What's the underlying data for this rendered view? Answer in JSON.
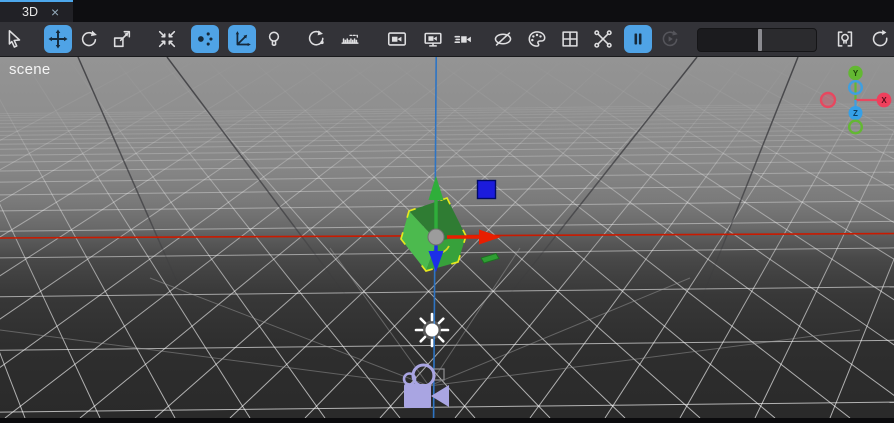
{
  "window": {
    "tab_label": "3D",
    "close_glyph": "×",
    "scene_label": "scene"
  },
  "toolbar": {
    "active_color": "#4fa3e6",
    "background": "#333338",
    "buttons": [
      {
        "name": "select-tool",
        "state": "normal"
      },
      {
        "name": "move-tool",
        "state": "active"
      },
      {
        "name": "rotate-tool",
        "state": "normal"
      },
      {
        "name": "scale-tool",
        "state": "normal"
      },
      {
        "name": "focus-selection",
        "state": "normal"
      },
      {
        "name": "snap-vertex",
        "state": "active"
      },
      {
        "name": "transform-space",
        "state": "active"
      },
      {
        "name": "lighting-toggle",
        "state": "normal"
      },
      {
        "name": "orbit-mode",
        "state": "normal"
      },
      {
        "name": "measure-ruler",
        "state": "normal"
      },
      {
        "name": "camera-view",
        "state": "normal"
      },
      {
        "name": "render-preview",
        "state": "normal"
      },
      {
        "name": "camera-speed",
        "state": "normal"
      },
      {
        "name": "toggle-hidden",
        "state": "normal"
      },
      {
        "name": "material-palette",
        "state": "normal"
      },
      {
        "name": "grid-toggle",
        "state": "normal"
      },
      {
        "name": "show-joints",
        "state": "normal"
      },
      {
        "name": "pause-simulation",
        "state": "active"
      },
      {
        "name": "play-animation",
        "state": "disabled"
      },
      {
        "name": "light-probe",
        "state": "normal"
      },
      {
        "name": "reset-view",
        "state": "normal"
      }
    ],
    "slider": {
      "name": "camera-speed-slider",
      "value_pct": 51
    }
  },
  "viewport": {
    "axis_labels": {
      "x": "X",
      "y": "Y",
      "z": "Z"
    },
    "colors": {
      "axis_x_line": "#c91a00",
      "axis_vertical_line": "#2d74c4",
      "selection_outline": "#e6e81e",
      "object_green_top": "#2f7c33",
      "object_green_left": "#4cba4e",
      "object_green_right": "#37a13b",
      "gizmo_x": "#e81e00",
      "gizmo_y": "#2fae3a",
      "gizmo_z": "#1c2fe8",
      "camera_icon": "#a9a5e2",
      "light_icon": "#ffffff",
      "navball_x": "#ef3f5c",
      "navball_y": "#63b832",
      "navball_z": "#35a0e8"
    }
  }
}
